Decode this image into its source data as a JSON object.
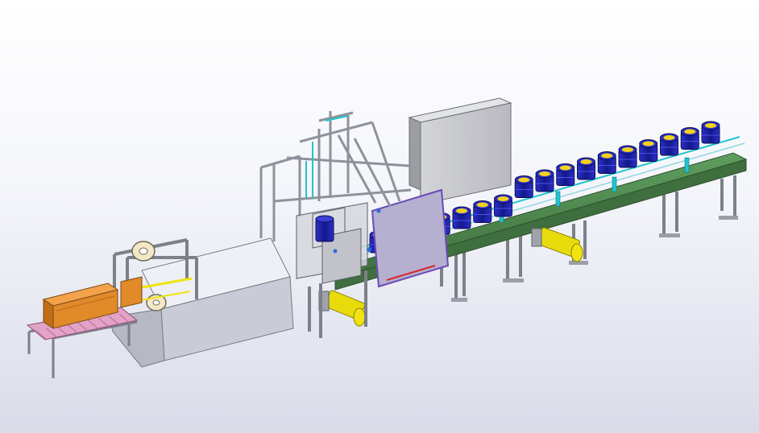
{
  "viewport": {
    "background_top": "#ffffff",
    "background_bottom": "#d9dbe8"
  },
  "model": {
    "cans_on_conveyor": 17,
    "colors": {
      "frame": "#8e929b",
      "frame_dark": "#5d616a",
      "conveyor_belt": "#4f8e4f",
      "conveyor_side": "#3f6e3f",
      "cabinet": "#c7c8cd",
      "cabinet_side": "#9c9da3",
      "can_body": "#1b1fa8",
      "can_top": "#f2d21b",
      "motor": "#f0e30f",
      "guide_rail": "#21c3cf",
      "box": "#e08a2a",
      "pink_rollers": "#e3a3c8",
      "accent_purple": "#6b4bb5",
      "accent_red": "#d9262a"
    },
    "components": [
      {
        "id": "long-conveyor",
        "label": ""
      },
      {
        "id": "robot-gantry",
        "label": ""
      },
      {
        "id": "electrical-cabinet",
        "label": ""
      },
      {
        "id": "box-sealer",
        "label": ""
      },
      {
        "id": "outfeed-roller-table",
        "label": ""
      },
      {
        "id": "drive-motor",
        "label": ""
      }
    ]
  }
}
